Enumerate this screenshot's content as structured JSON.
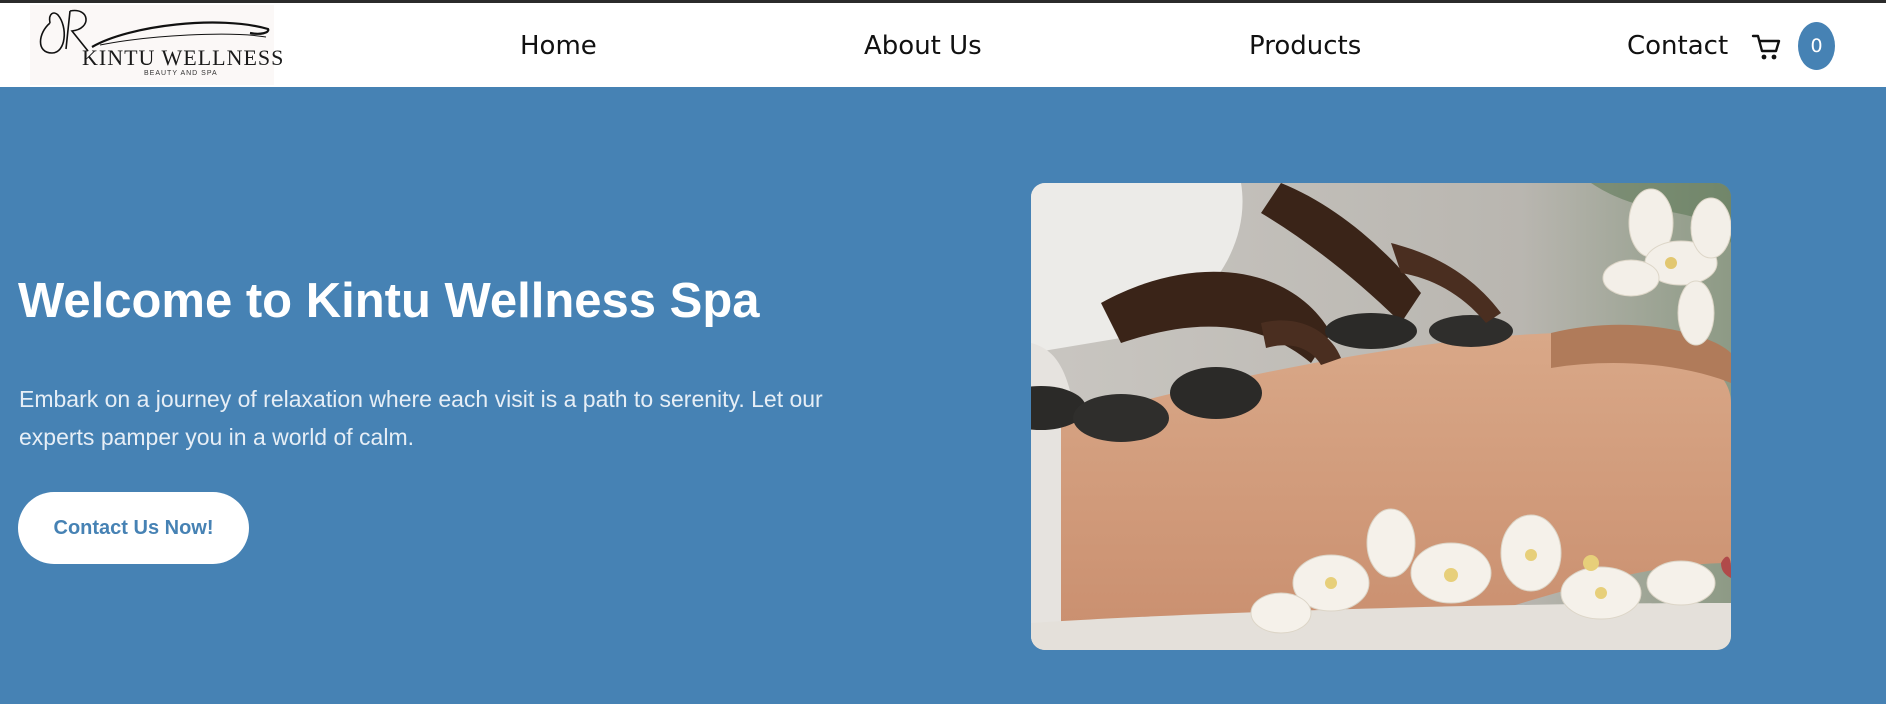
{
  "brand": {
    "logo_monogram": "JR",
    "logo_name": "KINTU WELLNESS",
    "logo_tagline": "BEAUTY AND SPA"
  },
  "nav": {
    "items": [
      {
        "label": "Home"
      },
      {
        "label": "About Us"
      },
      {
        "label": "Products"
      },
      {
        "label": "Contact"
      }
    ],
    "cart_icon": "shopping-cart-icon",
    "cart_count": "0"
  },
  "hero": {
    "title": "Welcome to Kintu Wellness Spa",
    "text": "Embark on a journey of relaxation where each visit is a path to serenity. Let our experts pamper you in a world of calm.",
    "cta_label": "Contact Us Now!"
  },
  "colors": {
    "accent": "#4682b4",
    "nav_background": "#ffffff",
    "button_text": "#4682b4"
  }
}
